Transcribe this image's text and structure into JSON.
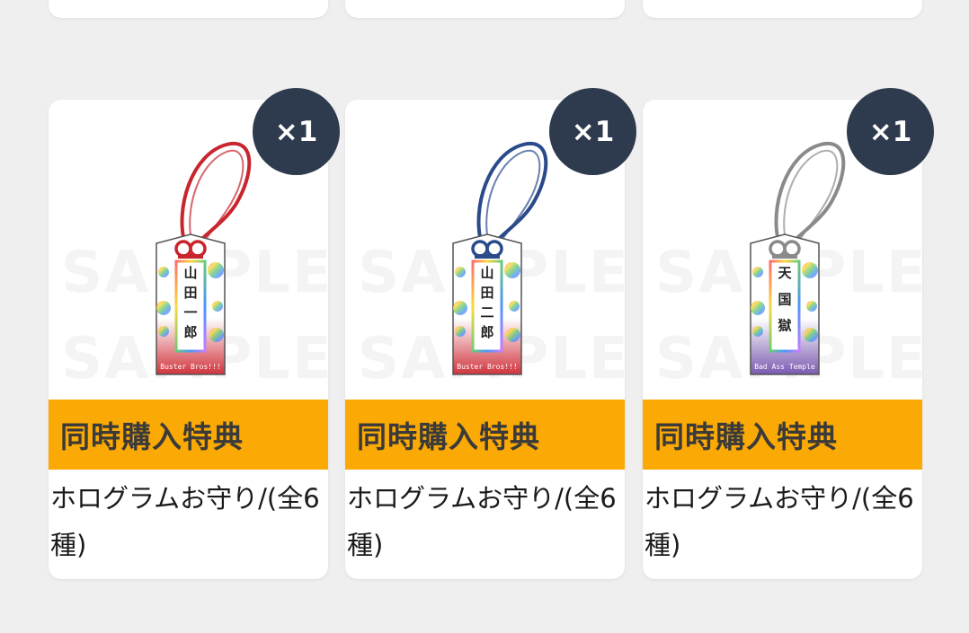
{
  "items": [
    {
      "quantity": "×1",
      "bonus_label": "同時購入特典",
      "product_name": "ホログラムお守り/(全6種)",
      "watermark": "SAMPLE",
      "cord_color": "#c8252d",
      "charm_name": "山田一郎",
      "charm_footer": "Buster Bros!!!",
      "charm_bottom_color": "#d0343d"
    },
    {
      "quantity": "×1",
      "bonus_label": "同時購入特典",
      "product_name": "ホログラムお守り/(全6種)",
      "watermark": "SAMPLE",
      "cord_color": "#2a4a8a",
      "charm_name": "山田二郎",
      "charm_footer": "Buster Bros!!!",
      "charm_bottom_color": "#d0343d"
    },
    {
      "quantity": "×1",
      "bonus_label": "同時購入特典",
      "product_name": "ホログラムお守り/(全6種)",
      "watermark": "SAMPLE",
      "cord_color": "#8a8a8a",
      "charm_name": "天国獄",
      "charm_footer": "Bad Ass Temple",
      "charm_bottom_color": "#7a5ab0"
    }
  ]
}
